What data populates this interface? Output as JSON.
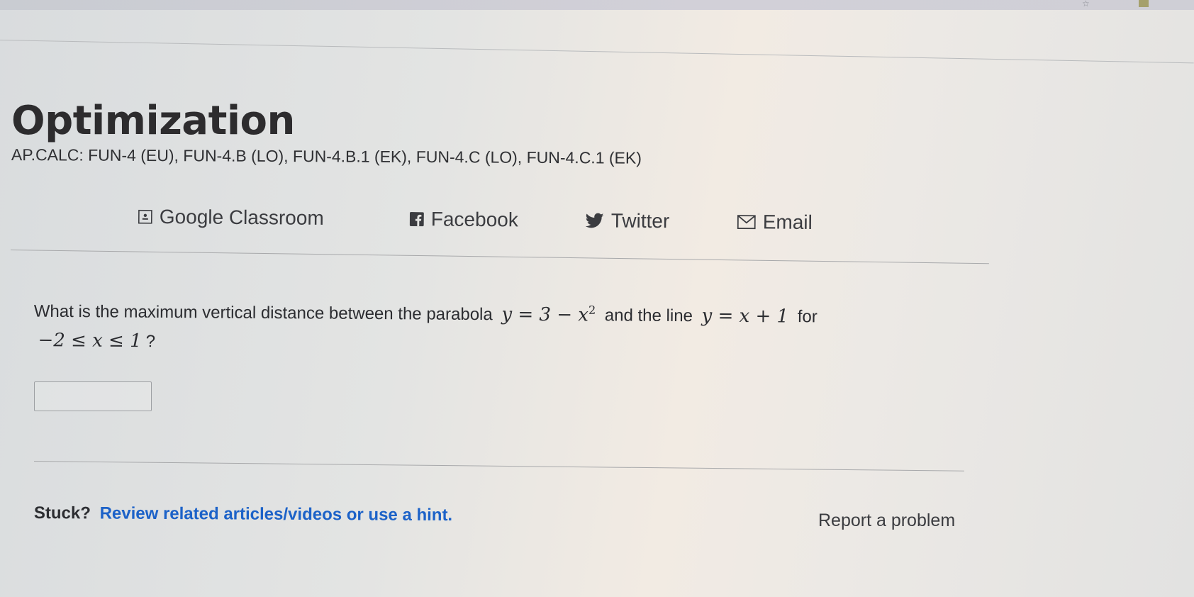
{
  "page": {
    "title": "Optimization",
    "standards": "AP.CALC: FUN-4 (EU), FUN-4.B (LO), FUN-4.B.1 (EK), FUN-4.C (LO), FUN-4.C.1 (EK)"
  },
  "share": {
    "google_classroom": "Google Classroom",
    "facebook": "Facebook",
    "twitter": "Twitter",
    "email": "Email"
  },
  "question": {
    "part1": "What is the maximum vertical distance between the parabola",
    "expr1": "y = 3 − x",
    "expr1_exp": "2",
    "part2": "and the line",
    "expr2": "y = x + 1",
    "part3": "for",
    "expr3": "−2 ≤ x ≤ 1",
    "end": "?"
  },
  "answer": {
    "value": ""
  },
  "footer": {
    "stuck_label": "Stuck?",
    "hint_link": "Review related articles/videos or use a hint.",
    "report_link": "Report a problem"
  },
  "colors": {
    "link_blue": "#1c62c8",
    "text_dark": "#2b2c30"
  }
}
